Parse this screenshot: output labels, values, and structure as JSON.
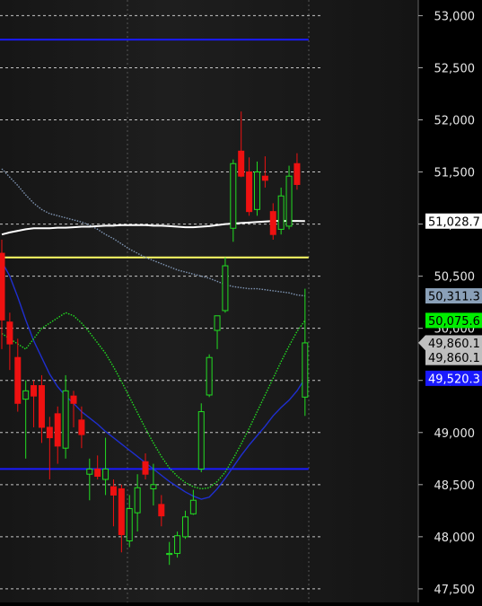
{
  "chart_data": {
    "type": "candlestick",
    "y_axis": {
      "ticks": [
        53000,
        52500,
        52000,
        51500,
        51000,
        50500,
        50000,
        49500,
        49000,
        48500,
        48000,
        47500
      ],
      "tick_labels": [
        "53,000",
        "52,500",
        "52,000",
        "51,500",
        "51,000",
        "50,500",
        "50,000",
        "49,500",
        "49,000",
        "48,500",
        "48,000",
        "47,500"
      ],
      "ylim": [
        47370,
        53150
      ],
      "position": "right"
    },
    "grid": {
      "horizontal": "dashed",
      "vertical": "dashed"
    },
    "candles": [
      {
        "o": 50720,
        "h": 50850,
        "l": 49800,
        "c": 50080
      },
      {
        "o": 50060,
        "h": 50150,
        "l": 49600,
        "c": 49850
      },
      {
        "o": 49720,
        "h": 49900,
        "l": 49200,
        "c": 49280
      },
      {
        "o": 49320,
        "h": 49500,
        "l": 48750,
        "c": 49400
      },
      {
        "o": 49450,
        "h": 49500,
        "l": 49050,
        "c": 49350
      },
      {
        "o": 49450,
        "h": 49550,
        "l": 48900,
        "c": 49050
      },
      {
        "o": 49050,
        "h": 49150,
        "l": 48550,
        "c": 48950
      },
      {
        "o": 49180,
        "h": 49250,
        "l": 48700,
        "c": 48870
      },
      {
        "o": 48850,
        "h": 49550,
        "l": 48750,
        "c": 49400
      },
      {
        "o": 49350,
        "h": 49400,
        "l": 49050,
        "c": 49280
      },
      {
        "o": 49120,
        "h": 49250,
        "l": 48850,
        "c": 48980
      },
      {
        "o": 48600,
        "h": 48750,
        "l": 48350,
        "c": 48650
      },
      {
        "o": 48650,
        "h": 48780,
        "l": 48550,
        "c": 48580
      },
      {
        "o": 48550,
        "h": 48950,
        "l": 48400,
        "c": 48650
      },
      {
        "o": 48480,
        "h": 48550,
        "l": 48100,
        "c": 48400
      },
      {
        "o": 48460,
        "h": 48500,
        "l": 47850,
        "c": 48020
      },
      {
        "o": 47960,
        "h": 48400,
        "l": 47900,
        "c": 48270
      },
      {
        "o": 48230,
        "h": 48600,
        "l": 48050,
        "c": 48470
      },
      {
        "o": 48720,
        "h": 48800,
        "l": 48550,
        "c": 48600
      },
      {
        "o": 48460,
        "h": 48700,
        "l": 48300,
        "c": 48500
      },
      {
        "o": 48310,
        "h": 48400,
        "l": 48100,
        "c": 48200
      },
      {
        "o": 47830,
        "h": 47950,
        "l": 47730,
        "c": 47840
      },
      {
        "o": 47840,
        "h": 48050,
        "l": 47800,
        "c": 48010
      },
      {
        "o": 48000,
        "h": 48250,
        "l": 47980,
        "c": 48190
      },
      {
        "o": 48220,
        "h": 48450,
        "l": 48210,
        "c": 48350
      },
      {
        "o": 48650,
        "h": 49280,
        "l": 48620,
        "c": 49200
      },
      {
        "o": 49360,
        "h": 49750,
        "l": 49340,
        "c": 49720
      },
      {
        "o": 49980,
        "h": 50100,
        "l": 49800,
        "c": 50120
      },
      {
        "o": 50170,
        "h": 50680,
        "l": 50150,
        "c": 50600
      },
      {
        "o": 50960,
        "h": 51620,
        "l": 50830,
        "c": 51580
      },
      {
        "o": 51700,
        "h": 52080,
        "l": 51450,
        "c": 51460
      },
      {
        "o": 51500,
        "h": 51640,
        "l": 51080,
        "c": 51120
      },
      {
        "o": 51140,
        "h": 51600,
        "l": 51080,
        "c": 51500
      },
      {
        "o": 51460,
        "h": 51650,
        "l": 51350,
        "c": 51420
      },
      {
        "o": 51120,
        "h": 51200,
        "l": 50850,
        "c": 50900
      },
      {
        "o": 50950,
        "h": 51350,
        "l": 50900,
        "c": 51270
      },
      {
        "o": 50980,
        "h": 51560,
        "l": 50950,
        "c": 51460
      },
      {
        "o": 51580,
        "h": 51680,
        "l": 51330,
        "c": 51380
      },
      {
        "o": 49340,
        "h": 50380,
        "l": 49160,
        "c": 49860
      }
    ],
    "horizontal_lines": [
      {
        "value": 52770,
        "color": "#1a1aff"
      },
      {
        "value": 50680,
        "color": "#ffff66"
      },
      {
        "value": 48650,
        "color": "#1a1aff"
      }
    ],
    "indicators": [
      {
        "style": "dotted",
        "color": "#7f95b3",
        "values": [
          51530,
          51450,
          51370,
          51280,
          51200,
          51140,
          51100,
          51080,
          51060,
          51040,
          51020,
          50990,
          50950,
          50900,
          50860,
          50810,
          50760,
          50720,
          50680,
          50650,
          50620,
          50590,
          50560,
          50540,
          50520,
          50500,
          50480,
          50450,
          50420,
          50400,
          50390,
          50380,
          50380,
          50370,
          50360,
          50350,
          50340,
          50320,
          50311
        ]
      },
      {
        "style": "solid",
        "color": "#1f2fd0",
        "values": [
          50640,
          50500,
          50300,
          50080,
          49880,
          49720,
          49560,
          49440,
          49350,
          49280,
          49200,
          49140,
          49080,
          49010,
          48950,
          48890,
          48830,
          48770,
          48710,
          48650,
          48590,
          48530,
          48480,
          48430,
          48390,
          48360,
          48380,
          48460,
          48560,
          48670,
          48780,
          48880,
          48970,
          49060,
          49160,
          49240,
          49310,
          49400,
          49520
        ]
      },
      {
        "style": "dotted",
        "color": "#22dd22",
        "values": [
          49950,
          49900,
          49850,
          49800,
          49900,
          50000,
          50050,
          50100,
          50150,
          50120,
          50050,
          49960,
          49860,
          49760,
          49630,
          49490,
          49340,
          49190,
          49040,
          48900,
          48770,
          48660,
          48580,
          48520,
          48480,
          48460,
          48470,
          48530,
          48620,
          48750,
          48890,
          49040,
          49200,
          49360,
          49520,
          49680,
          49830,
          49970,
          50075
        ]
      },
      {
        "style": "solid",
        "color": "#ffffff",
        "values": [
          50900,
          50920,
          50935,
          50950,
          50960,
          50960,
          50960,
          50965,
          50965,
          50970,
          50975,
          50975,
          50980,
          50985,
          50985,
          50990,
          50990,
          50990,
          50990,
          50985,
          50985,
          50980,
          50975,
          50970,
          50970,
          50975,
          50980,
          50990,
          51000,
          51005,
          51010,
          51015,
          51020,
          51025,
          51030,
          51030,
          51030,
          51030,
          51029
        ]
      }
    ],
    "price_labels": [
      {
        "text": "51,028.7",
        "value": 51028.7,
        "bg": "#ffffff",
        "fg": "#000000",
        "arrow": false
      },
      {
        "text": "50,311.3",
        "value": 50311.3,
        "bg": "#8aa0b8",
        "fg": "#000000",
        "arrow": false
      },
      {
        "text": "50,075.6",
        "value": 50075.6,
        "bg": "#00ee00",
        "fg": "#000000",
        "arrow": false
      },
      {
        "text": "49,860.1",
        "value": 49860.1,
        "bg": "#bfbfbf",
        "fg": "#000000",
        "arrow": true
      },
      {
        "text": "49,860.1",
        "value": 49720,
        "bg": "#bfbfbf",
        "fg": "#000000",
        "arrow": false
      },
      {
        "text": "49,520.3",
        "value": 49520.3,
        "bg": "#1a1aff",
        "fg": "#ffffff",
        "arrow": false
      }
    ],
    "colors": {
      "up_candle": "#22dd22",
      "down_candle": "#ee1111",
      "background": "#1c1c1c",
      "axis_bg": "#000000",
      "grid": "#ffffff"
    }
  }
}
